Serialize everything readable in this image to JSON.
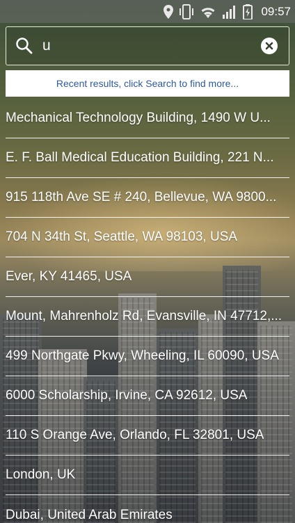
{
  "status_bar": {
    "time": "09:57",
    "icons": [
      "location-icon",
      "vibrate-icon",
      "wifi-icon",
      "signal-icon",
      "battery-charging-icon"
    ]
  },
  "search": {
    "value": "u",
    "placeholder": "",
    "icon": "search-icon",
    "clear_icon": "close-icon"
  },
  "hint": {
    "text": "Recent results, click Search to find more..."
  },
  "results": [
    "Mechanical Technology Building, 1490 W U...",
    "E. F. Ball Medical Education Building, 221 N...",
    "915 118th Ave SE # 240, Bellevue, WA 9800...",
    "704 N 34th St, Seattle, WA 98103, USA",
    "Ever, KY 41465, USA",
    "Mount, Mahrenholz Rd, Evansville, IN 47712,...",
    "499 Northgate Pkwy, Wheeling, IL 60090, USA",
    "6000 Scholarship, Irvine, CA 92612, USA",
    "110 S Orange Ave, Orlando, FL 32801, USA",
    "London, UK",
    "Dubai, United Arab Emirates"
  ],
  "colors": {
    "hint_text": "#2c5aa0",
    "list_text": "#ffffff",
    "divider": "#ffffff"
  }
}
